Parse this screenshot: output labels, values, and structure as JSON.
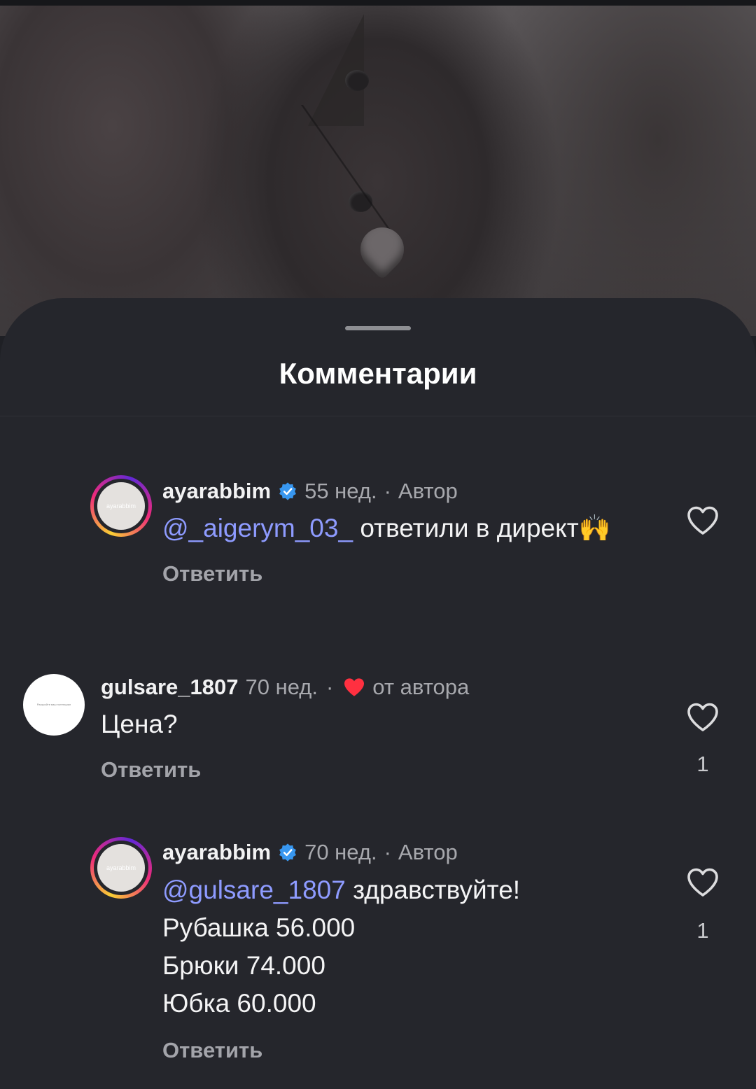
{
  "sheet": {
    "title": "Комментарии"
  },
  "comments": [
    {
      "avatar_text": "ayarabbim",
      "username": "ayarabbim",
      "time": "55 нед.",
      "separator": "·",
      "tag": "Автор",
      "mention": "@_aigerym_03_",
      "text": " ответили в директ🙌",
      "reply_label": "Ответить",
      "verified": true
    },
    {
      "avatar_text": "Раскройте ваш потенциал",
      "username": "gulsare_1807",
      "time": "70 нед.",
      "separator": "·",
      "tag": "от автора",
      "text": "Цена?",
      "reply_label": "Ответить",
      "like_count": "1",
      "liked_by_author": true
    },
    {
      "avatar_text": "ayarabbim",
      "username": "ayarabbim",
      "time": "70 нед.",
      "separator": "·",
      "tag": "Автор",
      "mention": "@gulsare_1807",
      "text": " здравствуйте!",
      "lines": [
        "Рубашка 56.000",
        "Брюки 74.000",
        "Юбка 60.000"
      ],
      "reply_label": "Ответить",
      "like_count": "1",
      "verified": true
    }
  ],
  "colors": {
    "sheet_bg": "#25262c",
    "mention": "#8e9bff",
    "verified": "#3897f0",
    "heart_red": "#ff3040"
  }
}
